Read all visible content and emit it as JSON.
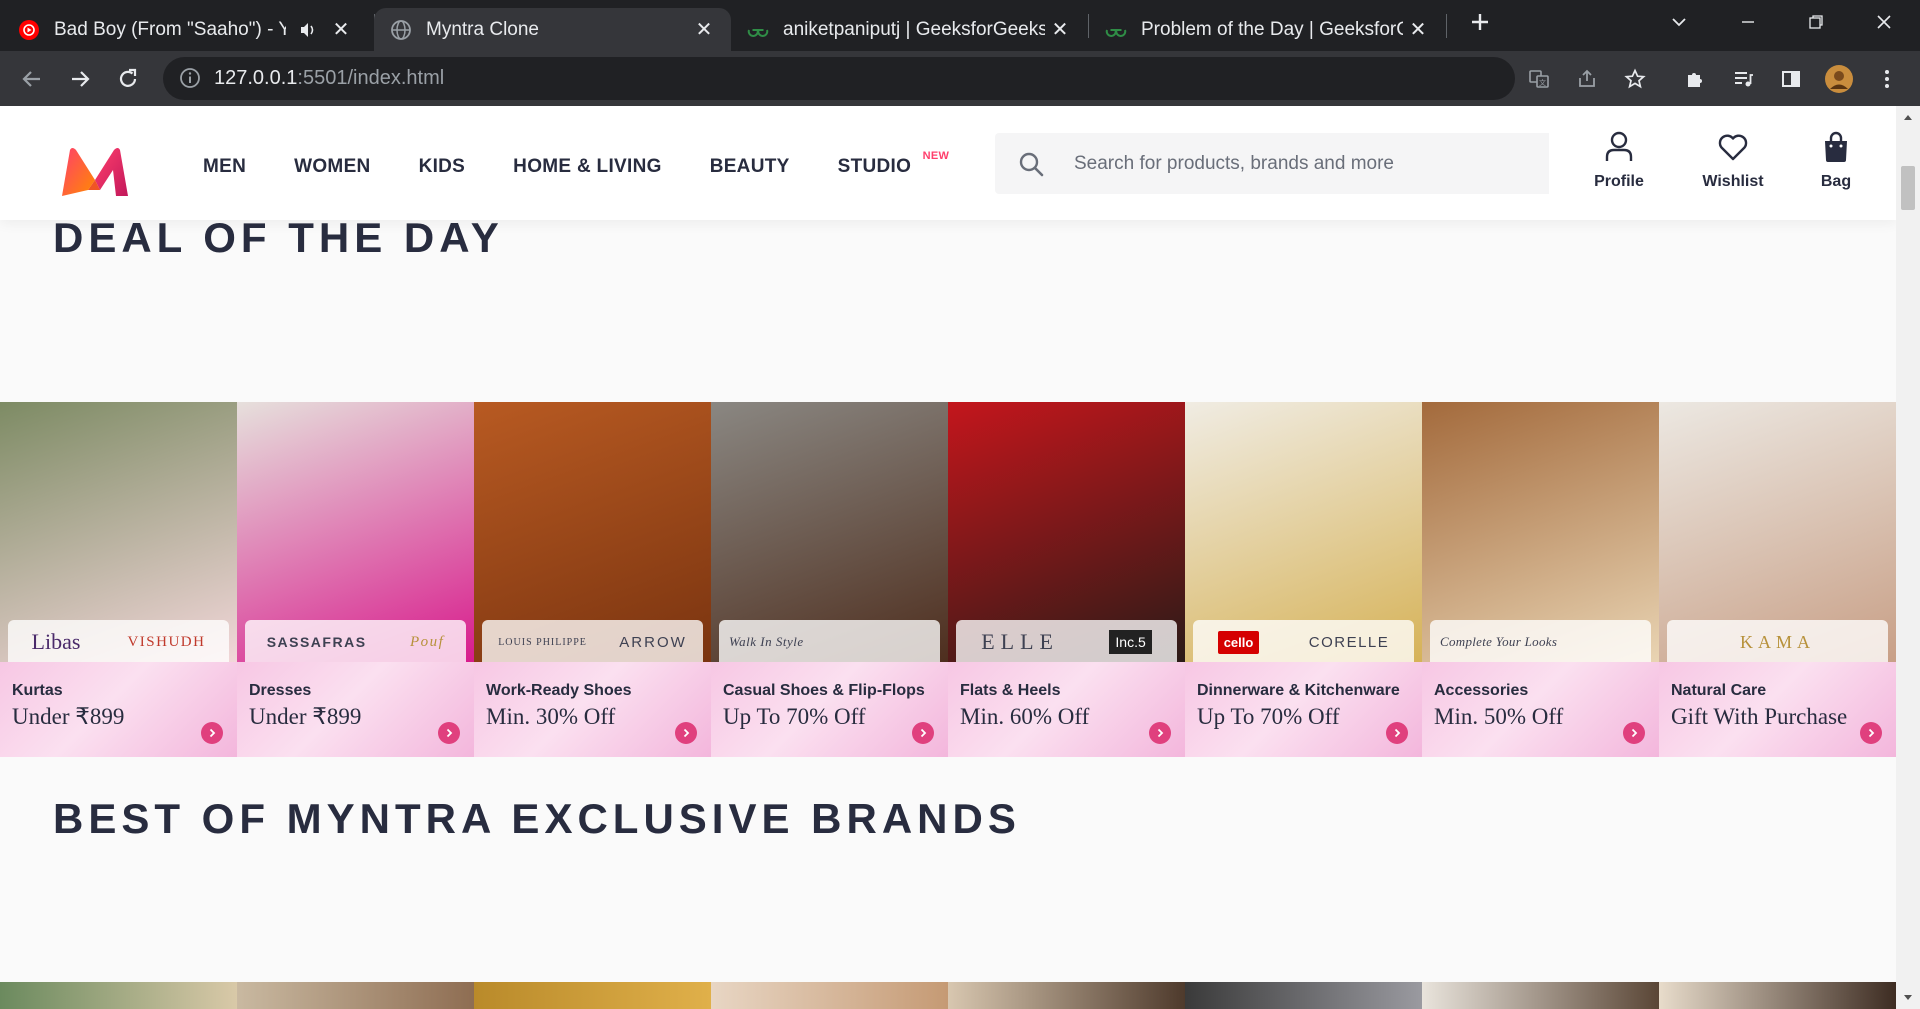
{
  "browser": {
    "tabs": [
      {
        "title": "Bad Boy (From \"Saaho\") - YouTube",
        "favicon": "youtube-icon",
        "audio": true,
        "active": false
      },
      {
        "title": "Myntra Clone",
        "favicon": "globe-icon",
        "active": true
      },
      {
        "title": "aniketpaniputj | GeeksforGeeks P",
        "favicon": "geeksforgeeks-icon",
        "active": false
      },
      {
        "title": "Problem of the Day | GeeksforGe",
        "favicon": "geeksforgeeks-icon",
        "active": false
      }
    ],
    "address": {
      "host": "127.0.0.1",
      "path": ":5501/index.html"
    }
  },
  "header": {
    "logo": "myntra-logo",
    "nav": [
      {
        "label": "MEN"
      },
      {
        "label": "WOMEN"
      },
      {
        "label": "KIDS"
      },
      {
        "label": "HOME & LIVING"
      },
      {
        "label": "BEAUTY"
      },
      {
        "label": "STUDIO",
        "badge": "NEW"
      }
    ],
    "search": {
      "placeholder": "Search for products, brands and more"
    },
    "actions": [
      {
        "label": "Profile",
        "icon": "user-icon"
      },
      {
        "label": "Wishlist",
        "icon": "heart-icon"
      },
      {
        "label": "Bag",
        "icon": "bag-icon"
      }
    ]
  },
  "sections": {
    "deal_title": "DEAL OF THE DAY",
    "brands_title": "BEST OF MYNTRA EXCLUSIVE BRANDS"
  },
  "deals": [
    {
      "category": "Kurtas",
      "offer": "Under ₹899",
      "brands": [
        "Libas",
        "VISHUDH"
      ],
      "colors": [
        "#7d8b64",
        "#f2d7d9"
      ]
    },
    {
      "category": "Dresses",
      "offer": "Under ₹899",
      "brands": [
        "SASSAFRAS",
        "Pouf"
      ],
      "colors": [
        "#e6e0dc",
        "#d81b8c"
      ]
    },
    {
      "category": "Work-Ready Shoes",
      "offer": "Min. 30% Off",
      "brands": [
        "LOUIS PHILIPPE",
        "ARROW"
      ],
      "colors": [
        "#b85a22",
        "#7a3410"
      ]
    },
    {
      "category": "Casual Shoes & Flip-Flops",
      "offer": "Up To 70% Off",
      "brands": [
        "Walk In Style"
      ],
      "colors": [
        "#8a8782",
        "#4e2e1e"
      ]
    },
    {
      "category": "Flats & Heels",
      "offer": "Min. 60% Off",
      "brands": [
        "ELLE",
        "Inc.5"
      ],
      "colors": [
        "#c4161c",
        "#2b1b17"
      ]
    },
    {
      "category": "Dinnerware & Kitchenware",
      "offer": "Up To 70% Off",
      "brands": [
        "cello",
        "CORELLE"
      ],
      "colors": [
        "#f0ece3",
        "#d6b257"
      ]
    },
    {
      "category": "Accessories",
      "offer": "Min. 50% Off",
      "brands": [
        "Complete Your Looks"
      ],
      "colors": [
        "#a36a3c",
        "#e9d4b3"
      ]
    },
    {
      "category": "Natural Care",
      "offer": "Gift With Purchase",
      "brands": [
        "KAMA"
      ],
      "colors": [
        "#ece8e2",
        "#c89f86"
      ]
    }
  ]
}
